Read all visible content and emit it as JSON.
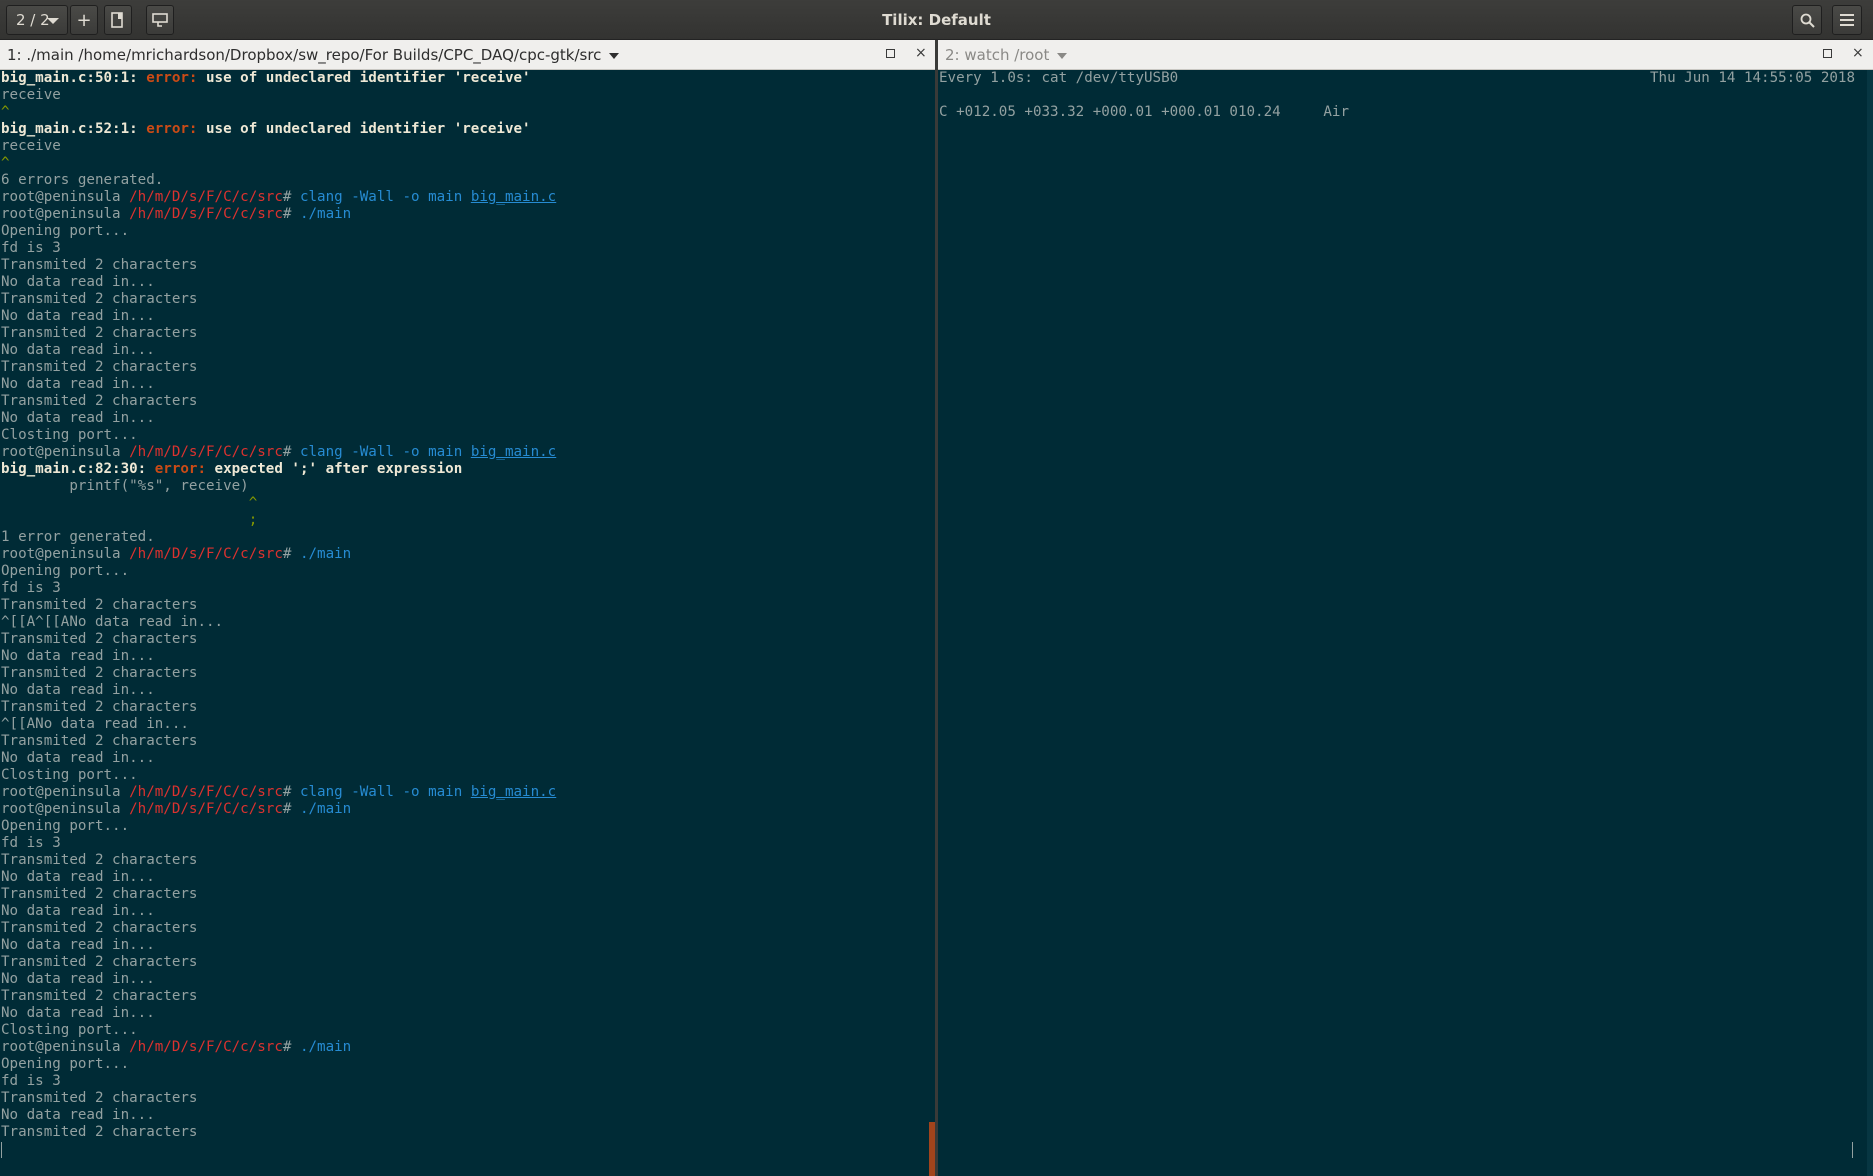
{
  "window": {
    "title": "Tilix: Default",
    "session_label": "2 / 2",
    "add_label": "+"
  },
  "left_pane": {
    "title": "1: ./main  /home/mrichardson/Dropbox/sw_repo/For Builds/CPC_DAQ/cpc-gtk/src",
    "prompt_user": "root@peninsula",
    "prompt_path": "/h/m/D/s/F/C/c/src",
    "lines": [
      {
        "type": "error",
        "loc": "big_main.c:50:1:",
        "label": "error:",
        "msg": "use of undeclared identifier 'receive'"
      },
      {
        "type": "text",
        "text": "receive"
      },
      {
        "type": "caret",
        "text": "^"
      },
      {
        "type": "error",
        "loc": "big_main.c:52:1:",
        "label": "error:",
        "msg": "use of undeclared identifier 'receive'"
      },
      {
        "type": "text",
        "text": "receive"
      },
      {
        "type": "caret",
        "text": "^"
      },
      {
        "type": "text",
        "text": "6 errors generated."
      },
      {
        "type": "prompt",
        "cmd": "clang",
        "args": " -Wall -o main ",
        "file": "big_main.c"
      },
      {
        "type": "prompt",
        "cmd": "./main",
        "args": "",
        "file": ""
      },
      {
        "type": "text",
        "text": "Opening port..."
      },
      {
        "type": "text",
        "text": "fd is 3"
      },
      {
        "type": "text",
        "text": "Transmited 2 characters"
      },
      {
        "type": "text",
        "text": "No data read in..."
      },
      {
        "type": "text",
        "text": "Transmited 2 characters"
      },
      {
        "type": "text",
        "text": "No data read in..."
      },
      {
        "type": "text",
        "text": "Transmited 2 characters"
      },
      {
        "type": "text",
        "text": "No data read in..."
      },
      {
        "type": "text",
        "text": "Transmited 2 characters"
      },
      {
        "type": "text",
        "text": "No data read in..."
      },
      {
        "type": "text",
        "text": "Transmited 2 characters"
      },
      {
        "type": "text",
        "text": "No data read in..."
      },
      {
        "type": "text",
        "text": "Closting port..."
      },
      {
        "type": "prompt",
        "cmd": "clang",
        "args": " -Wall -o main ",
        "file": "big_main.c"
      },
      {
        "type": "error",
        "loc": "big_main.c:82:30:",
        "label": "error:",
        "msg": "expected ';' after expression"
      },
      {
        "type": "text",
        "text": "        printf(\"%s\", receive)"
      },
      {
        "type": "caret",
        "text": "                             ^"
      },
      {
        "type": "caret",
        "text": "                             ;"
      },
      {
        "type": "text",
        "text": "1 error generated."
      },
      {
        "type": "prompt",
        "cmd": "./main",
        "args": "",
        "file": ""
      },
      {
        "type": "text",
        "text": "Opening port..."
      },
      {
        "type": "text",
        "text": "fd is 3"
      },
      {
        "type": "text",
        "text": "Transmited 2 characters"
      },
      {
        "type": "text",
        "text": "^[[A^[[ANo data read in..."
      },
      {
        "type": "text",
        "text": "Transmited 2 characters"
      },
      {
        "type": "text",
        "text": "No data read in..."
      },
      {
        "type": "text",
        "text": "Transmited 2 characters"
      },
      {
        "type": "text",
        "text": "No data read in..."
      },
      {
        "type": "text",
        "text": "Transmited 2 characters"
      },
      {
        "type": "text",
        "text": "^[[ANo data read in..."
      },
      {
        "type": "text",
        "text": "Transmited 2 characters"
      },
      {
        "type": "text",
        "text": "No data read in..."
      },
      {
        "type": "text",
        "text": "Closting port..."
      },
      {
        "type": "prompt",
        "cmd": "clang",
        "args": " -Wall -o main ",
        "file": "big_main.c"
      },
      {
        "type": "prompt",
        "cmd": "./main",
        "args": "",
        "file": ""
      },
      {
        "type": "text",
        "text": "Opening port..."
      },
      {
        "type": "text",
        "text": "fd is 3"
      },
      {
        "type": "text",
        "text": "Transmited 2 characters"
      },
      {
        "type": "text",
        "text": "No data read in..."
      },
      {
        "type": "text",
        "text": "Transmited 2 characters"
      },
      {
        "type": "text",
        "text": "No data read in..."
      },
      {
        "type": "text",
        "text": "Transmited 2 characters"
      },
      {
        "type": "text",
        "text": "No data read in..."
      },
      {
        "type": "text",
        "text": "Transmited 2 characters"
      },
      {
        "type": "text",
        "text": "No data read in..."
      },
      {
        "type": "text",
        "text": "Transmited 2 characters"
      },
      {
        "type": "text",
        "text": "No data read in..."
      },
      {
        "type": "text",
        "text": "Closting port..."
      },
      {
        "type": "prompt",
        "cmd": "./main",
        "args": "",
        "file": ""
      },
      {
        "type": "text",
        "text": "Opening port..."
      },
      {
        "type": "text",
        "text": "fd is 3"
      },
      {
        "type": "text",
        "text": "Transmited 2 characters"
      },
      {
        "type": "text",
        "text": "No data read in..."
      },
      {
        "type": "text",
        "text": "Transmited 2 characters"
      }
    ]
  },
  "right_pane": {
    "title": "2: watch /root",
    "watch_command": "Every 1.0s: cat /dev/ttyUSB0",
    "watch_time": "Thu Jun 14 14:55:05 2018",
    "output": "C +012.05 +033.32 +000.01 +000.01 010.24     Air"
  },
  "colors": {
    "terminal_bg": "#002b36",
    "text": "#93a1a1",
    "error": "#cb4b16",
    "path": "#dc322f",
    "command": "#268bd2"
  },
  "icons": [
    "chevron-down-icon",
    "plus-icon",
    "split-icon",
    "sync-input-icon",
    "search-icon",
    "hamburger-menu-icon",
    "maximize-icon",
    "close-icon"
  ]
}
